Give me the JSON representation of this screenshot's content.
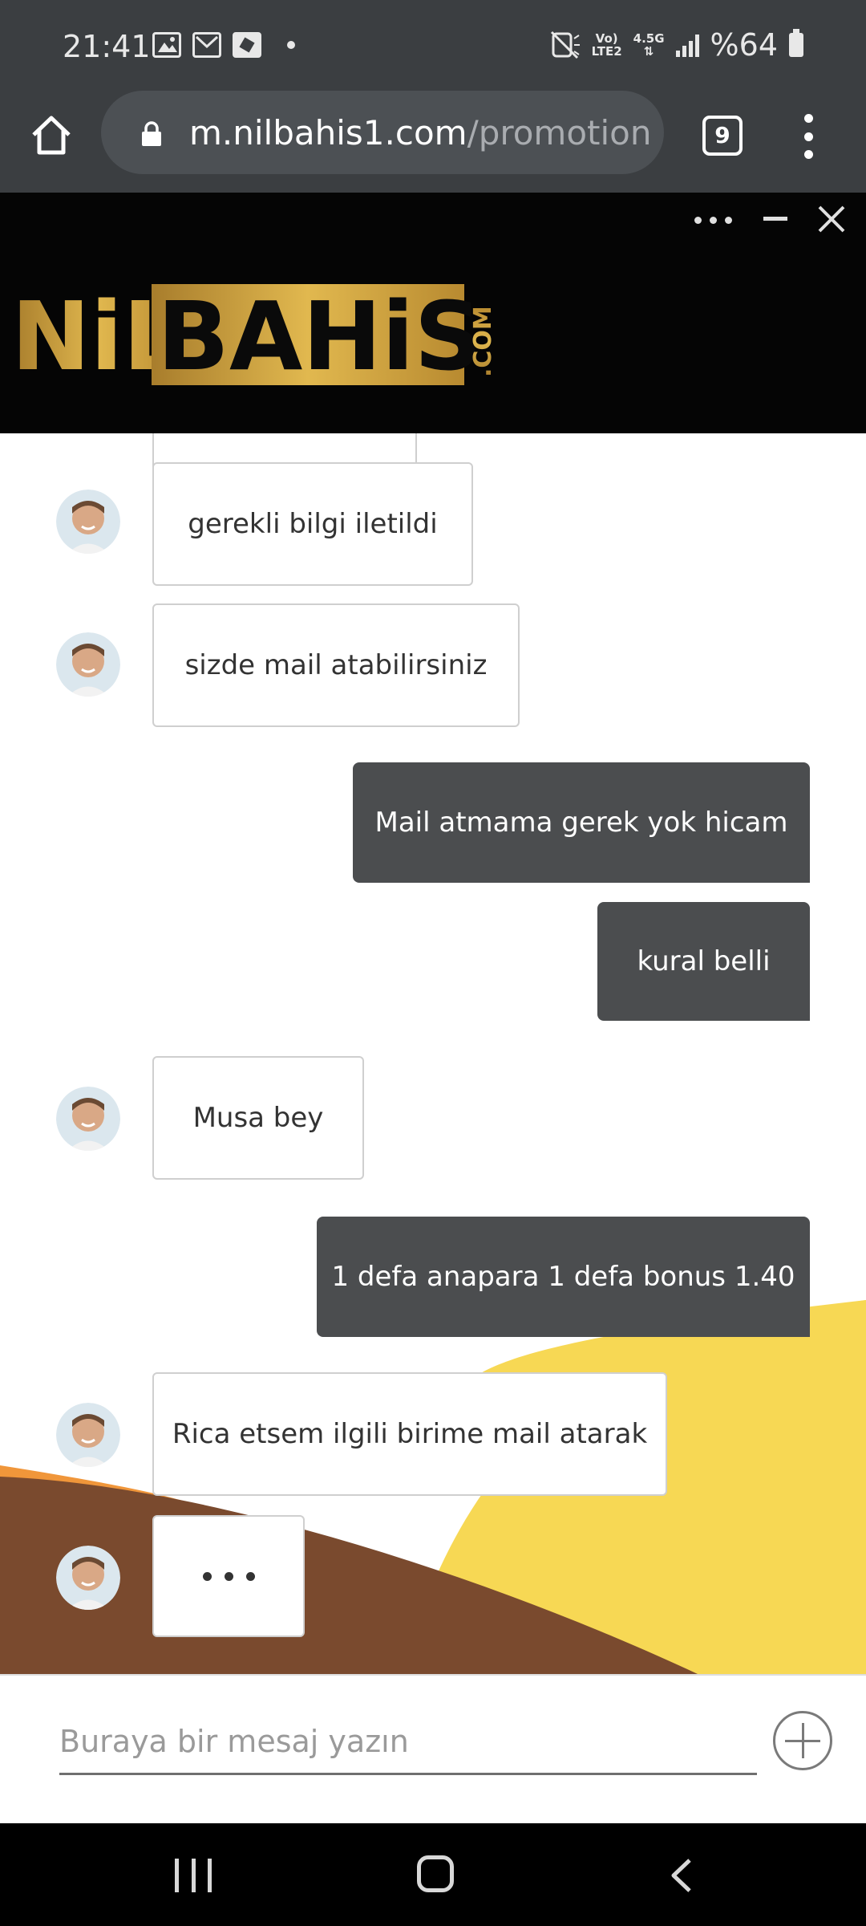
{
  "status_bar": {
    "time": "21:41",
    "network_top": "Vo)",
    "network_bottom": "LTE2",
    "network_gen": "4.5G",
    "battery": "%64",
    "icons": [
      "image-icon",
      "gmail-icon",
      "app-icon",
      "mute-icon",
      "signal-icon",
      "battery-icon"
    ]
  },
  "browser": {
    "url_domain": "m.nilbahis1.com",
    "url_path": "/promotion",
    "tab_count": "9"
  },
  "chat": {
    "brand": {
      "logo_text_main": "NiLBAHiS",
      "logo_text_suffix": ".COM",
      "accent": "#c9a13e"
    },
    "messages": [
      {
        "from": "agent",
        "text": "gerekli bilgi iletildi"
      },
      {
        "from": "agent",
        "text": "sizde mail atabilirsiniz"
      },
      {
        "from": "user",
        "text": "Mail atmama gerek yok hicam"
      },
      {
        "from": "user",
        "text": "kural belli"
      },
      {
        "from": "agent",
        "text": "Musa bey"
      },
      {
        "from": "user",
        "text": "1 defa anapara 1 defa bonus 1.40"
      },
      {
        "from": "agent",
        "text": "Rica etsem ilgili birime mail atarak"
      }
    ],
    "typing_indicator": true,
    "input_placeholder": "Buraya bir mesaj yazın"
  },
  "colors": {
    "status_bg": "#3b3e41",
    "header_bg": "#050505",
    "user_bubble": "#4b4d4f",
    "wave_yellow": "#f7d854",
    "wave_orange": "#f0963a",
    "wave_brown": "#7a4a2e"
  }
}
